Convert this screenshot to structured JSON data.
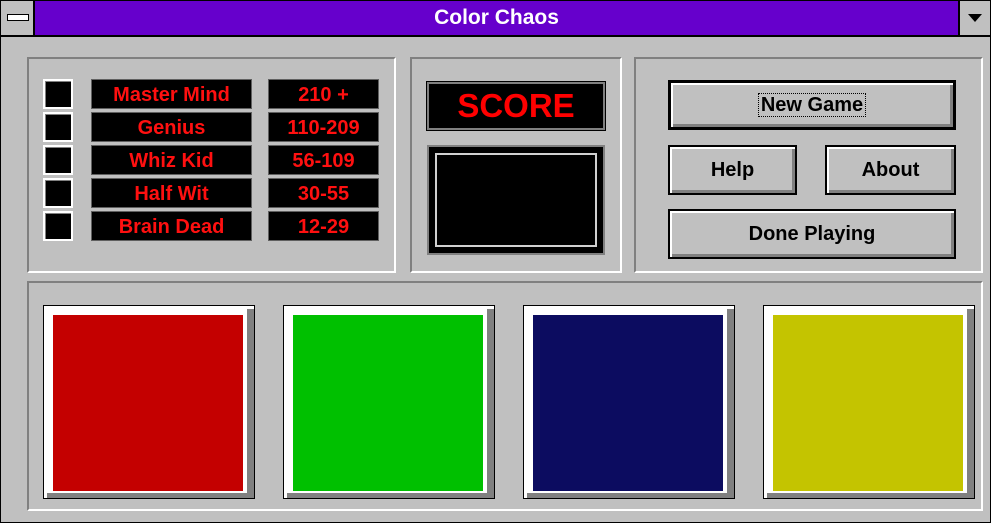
{
  "window": {
    "title": "Color Chaos"
  },
  "ranks": [
    {
      "name": "Master Mind",
      "range": "210 +"
    },
    {
      "name": "Genius",
      "range": "110-209"
    },
    {
      "name": "Whiz Kid",
      "range": "56-109"
    },
    {
      "name": "Half Wit",
      "range": "30-55"
    },
    {
      "name": "Brain Dead",
      "range": "12-29"
    }
  ],
  "score": {
    "label": "SCORE",
    "value": ""
  },
  "buttons": {
    "new_game": "New Game",
    "help": "Help",
    "about": "About",
    "done": "Done Playing"
  },
  "color_buttons": [
    {
      "name": "red",
      "color": "#c40000"
    },
    {
      "name": "green",
      "color": "#00c000"
    },
    {
      "name": "blue",
      "color": "#0c0c60"
    },
    {
      "name": "yellow",
      "color": "#c4c400"
    }
  ],
  "colors": {
    "titlebar": "#6600cc",
    "rank_text": "#ff1010",
    "score_text": "#ff0000",
    "face": "#c0c0c0"
  }
}
